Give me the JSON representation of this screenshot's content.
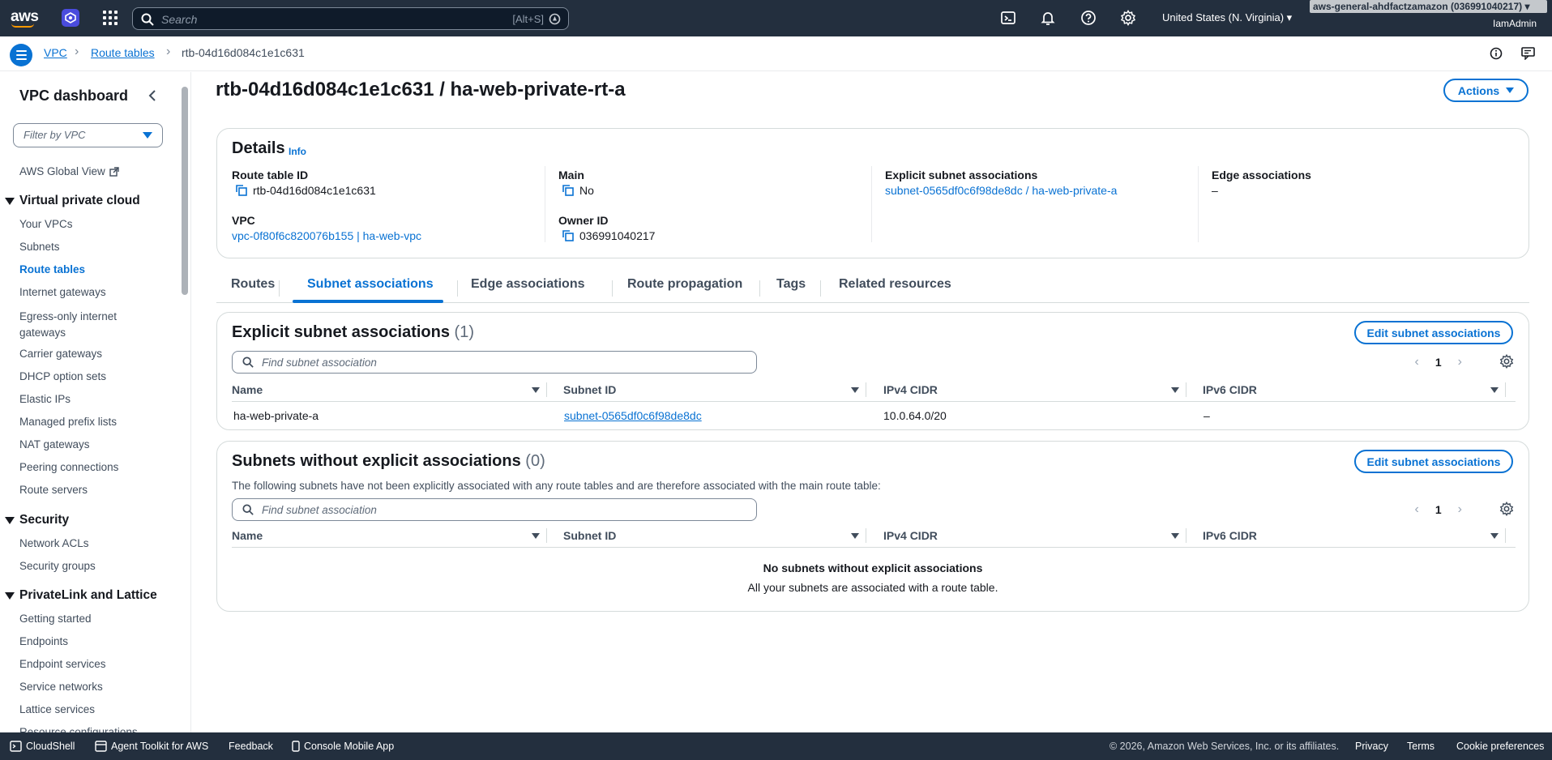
{
  "topnav": {
    "logo": "aws",
    "search_placeholder": "Search",
    "search_shortcut": "[Alt+S]",
    "region": "United States (N. Virginia)",
    "account": "aws-general-ahdfactzamazon (036991040217)",
    "user": "IamAdmin"
  },
  "breadcrumb": {
    "items": [
      "VPC",
      "Route tables",
      "rtb-04d16d084c1e1c631"
    ]
  },
  "sidenav": {
    "title": "VPC dashboard",
    "filter_placeholder": "Filter by VPC",
    "global_view": "AWS Global View",
    "sections": [
      {
        "label": "Virtual private cloud",
        "items": [
          "Your VPCs",
          "Subnets",
          "Route tables",
          "Internet gateways",
          "Egress-only internet gateways",
          "Carrier gateways",
          "DHCP option sets",
          "Elastic IPs",
          "Managed prefix lists",
          "NAT gateways",
          "Peering connections",
          "Route servers"
        ]
      },
      {
        "label": "Security",
        "items": [
          "Network ACLs",
          "Security groups"
        ]
      },
      {
        "label": "PrivateLink and Lattice",
        "items": [
          "Getting started",
          "Endpoints",
          "Endpoint services",
          "Service networks",
          "Lattice services",
          "Resource configurations"
        ]
      }
    ],
    "active_item": "Route tables"
  },
  "page": {
    "title": "rtb-04d16d084c1e1c631 / ha-web-private-rt-a",
    "actions_label": "Actions"
  },
  "details": {
    "heading": "Details",
    "info": "Info",
    "route_table_id_label": "Route table ID",
    "route_table_id": "rtb-04d16d084c1e1c631",
    "main_label": "Main",
    "main": "No",
    "explicit_label": "Explicit subnet associations",
    "explicit": "subnet-0565df0c6f98de8dc / ha-web-private-a",
    "edge_label": "Edge associations",
    "edge": "–",
    "vpc_label": "VPC",
    "vpc": "vpc-0f80f6c820076b155 | ha-web-vpc",
    "owner_label": "Owner ID",
    "owner": "036991040217"
  },
  "tabs": [
    "Routes",
    "Subnet associations",
    "Edge associations",
    "Route propagation",
    "Tags",
    "Related resources"
  ],
  "active_tab": "Subnet associations",
  "explicit_box": {
    "title": "Explicit subnet associations",
    "count": "(1)",
    "edit_label": "Edit subnet associations",
    "find_placeholder": "Find subnet association",
    "page": "1",
    "columns": [
      "Name",
      "Subnet ID",
      "IPv4 CIDR",
      "IPv6 CIDR"
    ],
    "rows": [
      {
        "name": "ha-web-private-a",
        "subnet_id": "subnet-0565df0c6f98de8dc",
        "ipv4": "10.0.64.0/20",
        "ipv6": "–"
      }
    ]
  },
  "without_box": {
    "title": "Subnets without explicit associations",
    "count": "(0)",
    "edit_label": "Edit subnet associations",
    "description": "The following subnets have not been explicitly associated with any route tables and are therefore associated with the main route table:",
    "find_placeholder": "Find subnet association",
    "page": "1",
    "columns": [
      "Name",
      "Subnet ID",
      "IPv4 CIDR",
      "IPv6 CIDR"
    ],
    "empty_title": "No subnets without explicit associations",
    "empty_text": "All your subnets are associated with a route table."
  },
  "footer": {
    "cloudshell": "CloudShell",
    "agent_toolkit": "Agent Toolkit for AWS",
    "feedback": "Feedback",
    "mobile_app": "Console Mobile App",
    "copyright": "© 2026, Amazon Web Services, Inc. or its affiliates.",
    "privacy": "Privacy",
    "terms": "Terms",
    "cookies": "Cookie preferences"
  },
  "colors": {
    "nav_bg": "#232f3e",
    "link": "#0972d3",
    "aws_orange": "#ff9900"
  }
}
